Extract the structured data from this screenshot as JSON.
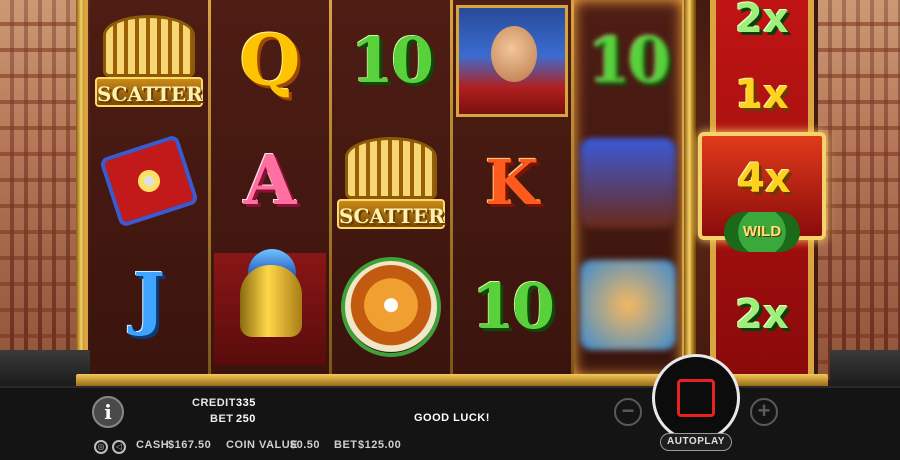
{
  "reels": {
    "reel1": [
      "scatter",
      "shield",
      "J"
    ],
    "reel2": [
      "Q",
      "A",
      "gladiator"
    ],
    "reel3": [
      "10",
      "scatter",
      "tiger"
    ],
    "reel4": [
      "caesar",
      "K",
      "10"
    ],
    "reel5": [
      "10",
      "chariot (spinning)",
      "lion (spinning)"
    ],
    "scatter_label": "SCATTER",
    "letters": {
      "q": "Q",
      "a": "A",
      "j": "J",
      "k": "K",
      "ten": "10"
    }
  },
  "multiplier_reel": {
    "values": [
      "2x",
      "1x",
      "4x",
      "2x"
    ],
    "highlighted": "4x",
    "wild_label": "WILD"
  },
  "status_bar": {
    "credit_label": "CREDIT",
    "credit_value": "335",
    "bet_label": "BET",
    "bet_value": "250",
    "message": "GOOD LUCK!",
    "cash_label": "CASH",
    "cash_value": "$167.50",
    "coin_value_label": "COIN VALUE",
    "coin_value_value": "$0.50",
    "total_bet_label": "BET",
    "total_bet_value": "$125.00"
  },
  "controls": {
    "info_icon": "i",
    "minus": "−",
    "plus": "+",
    "autoplay_label": "AUTOPLAY"
  },
  "colors": {
    "accent_gold": "#d9a441",
    "multiplier_red": "#c01414",
    "spin_stop": "#e82020"
  }
}
